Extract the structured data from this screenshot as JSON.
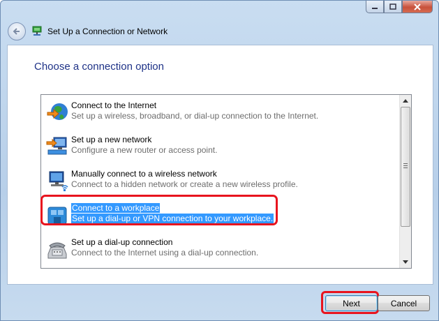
{
  "window": {
    "title": "Set Up a Connection or Network",
    "caption_buttons": [
      "minimize-icon",
      "maximize-icon",
      "close-icon"
    ]
  },
  "heading": "Choose a connection option",
  "options": [
    {
      "title": "Connect to the Internet",
      "description": "Set up a wireless, broadband, or dial-up connection to the Internet.",
      "icon": "globe-icon"
    },
    {
      "title": "Set up a new network",
      "description": "Configure a new router or access point.",
      "icon": "new-network-icon"
    },
    {
      "title": "Manually connect to a wireless network",
      "description": "Connect to a hidden network or create a new wireless profile.",
      "icon": "wireless-network-icon"
    },
    {
      "title": "Connect to a workplace",
      "description": "Set up a dial-up or VPN connection to your workplace.",
      "icon": "workplace-icon",
      "selected": true
    },
    {
      "title": "Set up a dial-up connection",
      "description": "Connect to the Internet using a dial-up connection.",
      "icon": "telephone-icon"
    }
  ],
  "buttons": {
    "next": "Next",
    "cancel": "Cancel"
  },
  "colors": {
    "heading": "#1e3287",
    "selection": "#3399ff",
    "annotation": "#e8141e"
  }
}
